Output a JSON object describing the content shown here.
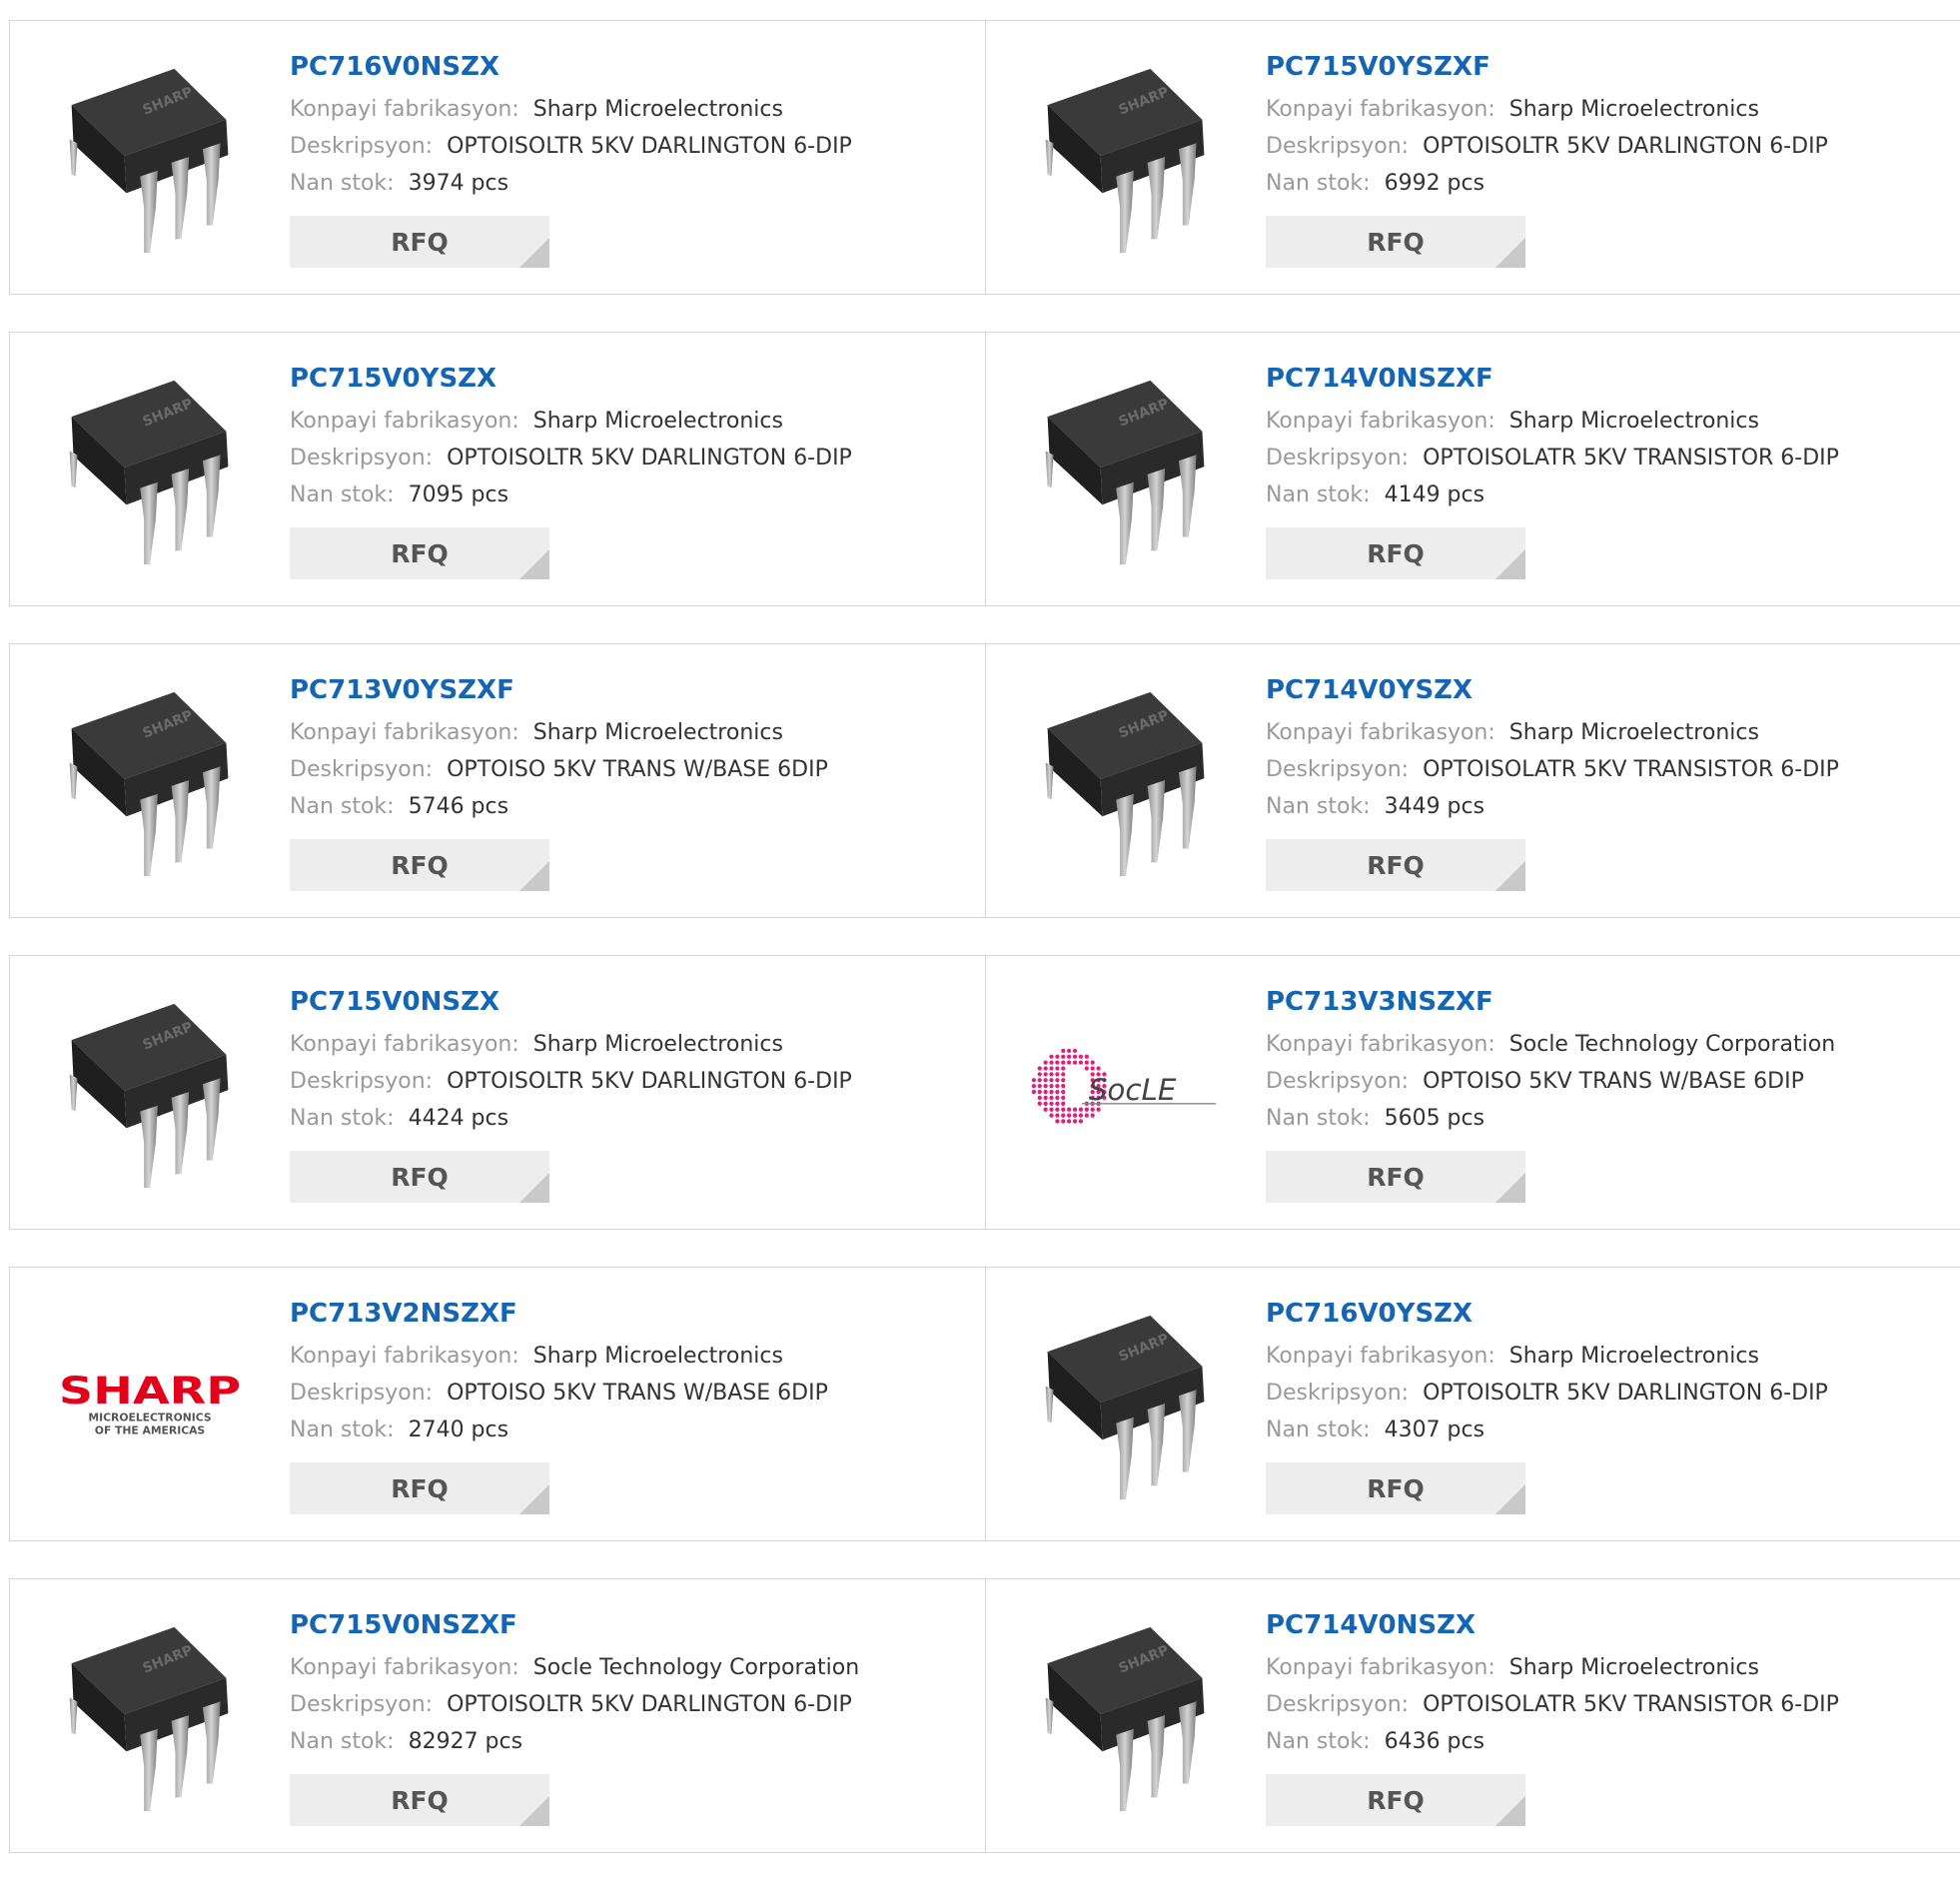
{
  "labels": {
    "manufacturer": "Konpayi fabrikasyon:",
    "description": "Deskripsyon:",
    "stock": "Nan stok:",
    "rfq": "RFQ"
  },
  "colors": {
    "part_link": "#1565b5",
    "label": "#9a9a9a",
    "button_bg": "#ededed"
  },
  "rows": [
    [
      {
        "part": "PC716V0NSZX",
        "manufacturer": "Sharp Microelectronics",
        "description": "OPTOISOLTR 5KV DARLINGTON 6-DIP",
        "stock": "3974 pcs",
        "image": "chip"
      },
      {
        "part": "PC715V0YSZXF",
        "manufacturer": "Sharp Microelectronics",
        "description": "OPTOISOLTR 5KV DARLINGTON 6-DIP",
        "stock": "6992 pcs",
        "image": "chip"
      }
    ],
    [
      {
        "part": "PC715V0YSZX",
        "manufacturer": "Sharp Microelectronics",
        "description": "OPTOISOLTR 5KV DARLINGTON 6-DIP",
        "stock": "7095 pcs",
        "image": "chip"
      },
      {
        "part": "PC714V0NSZXF",
        "manufacturer": "Sharp Microelectronics",
        "description": "OPTOISOLATR 5KV TRANSISTOR 6-DIP",
        "stock": "4149 pcs",
        "image": "chip"
      }
    ],
    [
      {
        "part": "PC713V0YSZXF",
        "manufacturer": "Sharp Microelectronics",
        "description": "OPTOISO 5KV TRANS W/BASE 6DIP",
        "stock": "5746 pcs",
        "image": "chip"
      },
      {
        "part": "PC714V0YSZX",
        "manufacturer": "Sharp Microelectronics",
        "description": "OPTOISOLATR 5KV TRANSISTOR 6-DIP",
        "stock": "3449 pcs",
        "image": "chip"
      }
    ],
    [
      {
        "part": "PC715V0NSZX",
        "manufacturer": "Sharp Microelectronics",
        "description": "OPTOISOLTR 5KV DARLINGTON 6-DIP",
        "stock": "4424 pcs",
        "image": "chip"
      },
      {
        "part": "PC713V3NSZXF",
        "manufacturer": "Socle Technology Corporation",
        "description": "OPTOISO 5KV TRANS W/BASE 6DIP",
        "stock": "5605 pcs",
        "image": "socle-logo"
      }
    ],
    [
      {
        "part": "PC713V2NSZXF",
        "manufacturer": "Sharp Microelectronics",
        "description": "OPTOISO 5KV TRANS W/BASE 6DIP",
        "stock": "2740 pcs",
        "image": "sharp-logo"
      },
      {
        "part": "PC716V0YSZX",
        "manufacturer": "Sharp Microelectronics",
        "description": "OPTOISOLTR 5KV DARLINGTON 6-DIP",
        "stock": "4307 pcs",
        "image": "chip"
      }
    ],
    [
      {
        "part": "PC715V0NSZXF",
        "manufacturer": "Socle Technology Corporation",
        "description": "OPTOISOLTR 5KV DARLINGTON 6-DIP",
        "stock": "82927 pcs",
        "image": "chip"
      },
      {
        "part": "PC714V0NSZX",
        "manufacturer": "Sharp Microelectronics",
        "description": "OPTOISOLATR 5KV TRANSISTOR 6-DIP",
        "stock": "6436 pcs",
        "image": "chip"
      }
    ]
  ],
  "logos": {
    "chip_marking": "SHARP",
    "socle": "SocLE",
    "sharp": "SHARP",
    "sharp_sub1": "MICROELECTRONICS",
    "sharp_sub2": "OF THE AMERICAS"
  }
}
